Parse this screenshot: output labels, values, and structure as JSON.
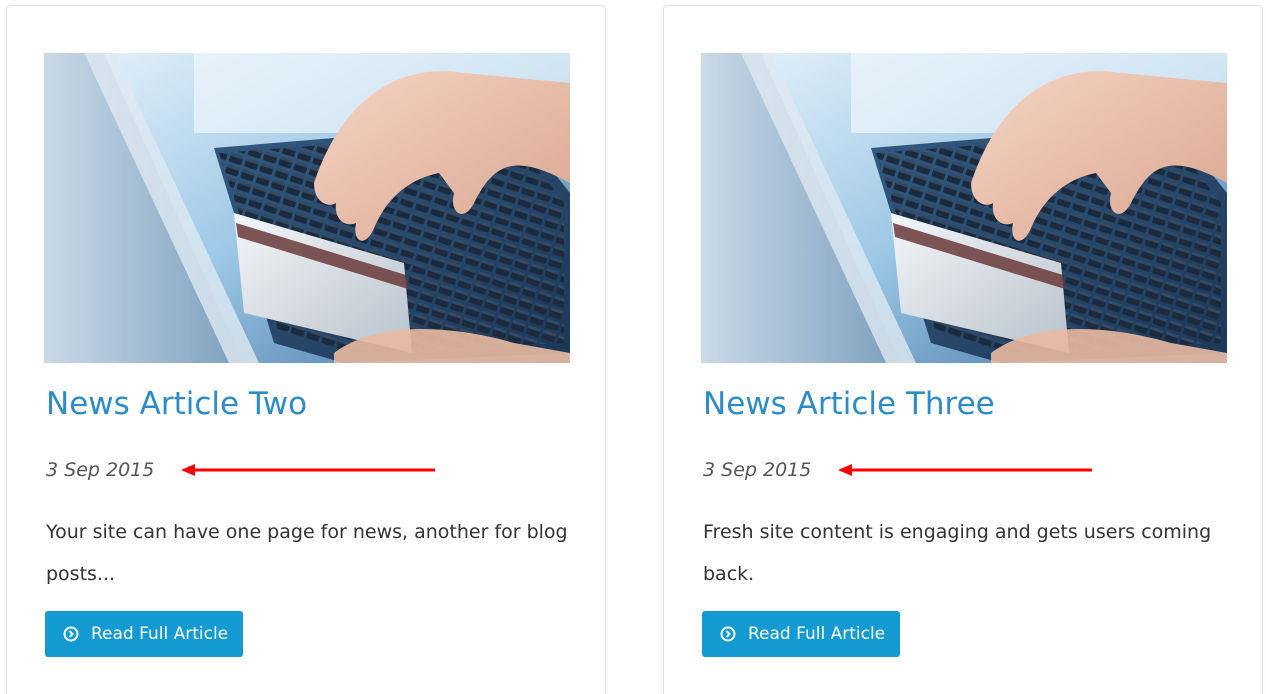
{
  "articles": [
    {
      "title": "News Article Two",
      "date": "3 Sep 2015",
      "excerpt": "Your site can have one page for news, another for blog posts...",
      "button_label": "Read Full Article",
      "button_icon": "circle-arrow-right-icon",
      "image": "laptop-credit-card-photo"
    },
    {
      "title": "News Article Three",
      "date": "3 Sep 2015",
      "excerpt": "Fresh site content is engaging and gets users coming back.",
      "button_label": "Read Full Article",
      "button_icon": "circle-arrow-right-icon",
      "image": "laptop-credit-card-photo"
    }
  ],
  "colors": {
    "title": "#2d8cc8",
    "button": "#139ad1",
    "annotation_arrow": "#ff0000",
    "date": "#555555",
    "excerpt": "#333333"
  }
}
